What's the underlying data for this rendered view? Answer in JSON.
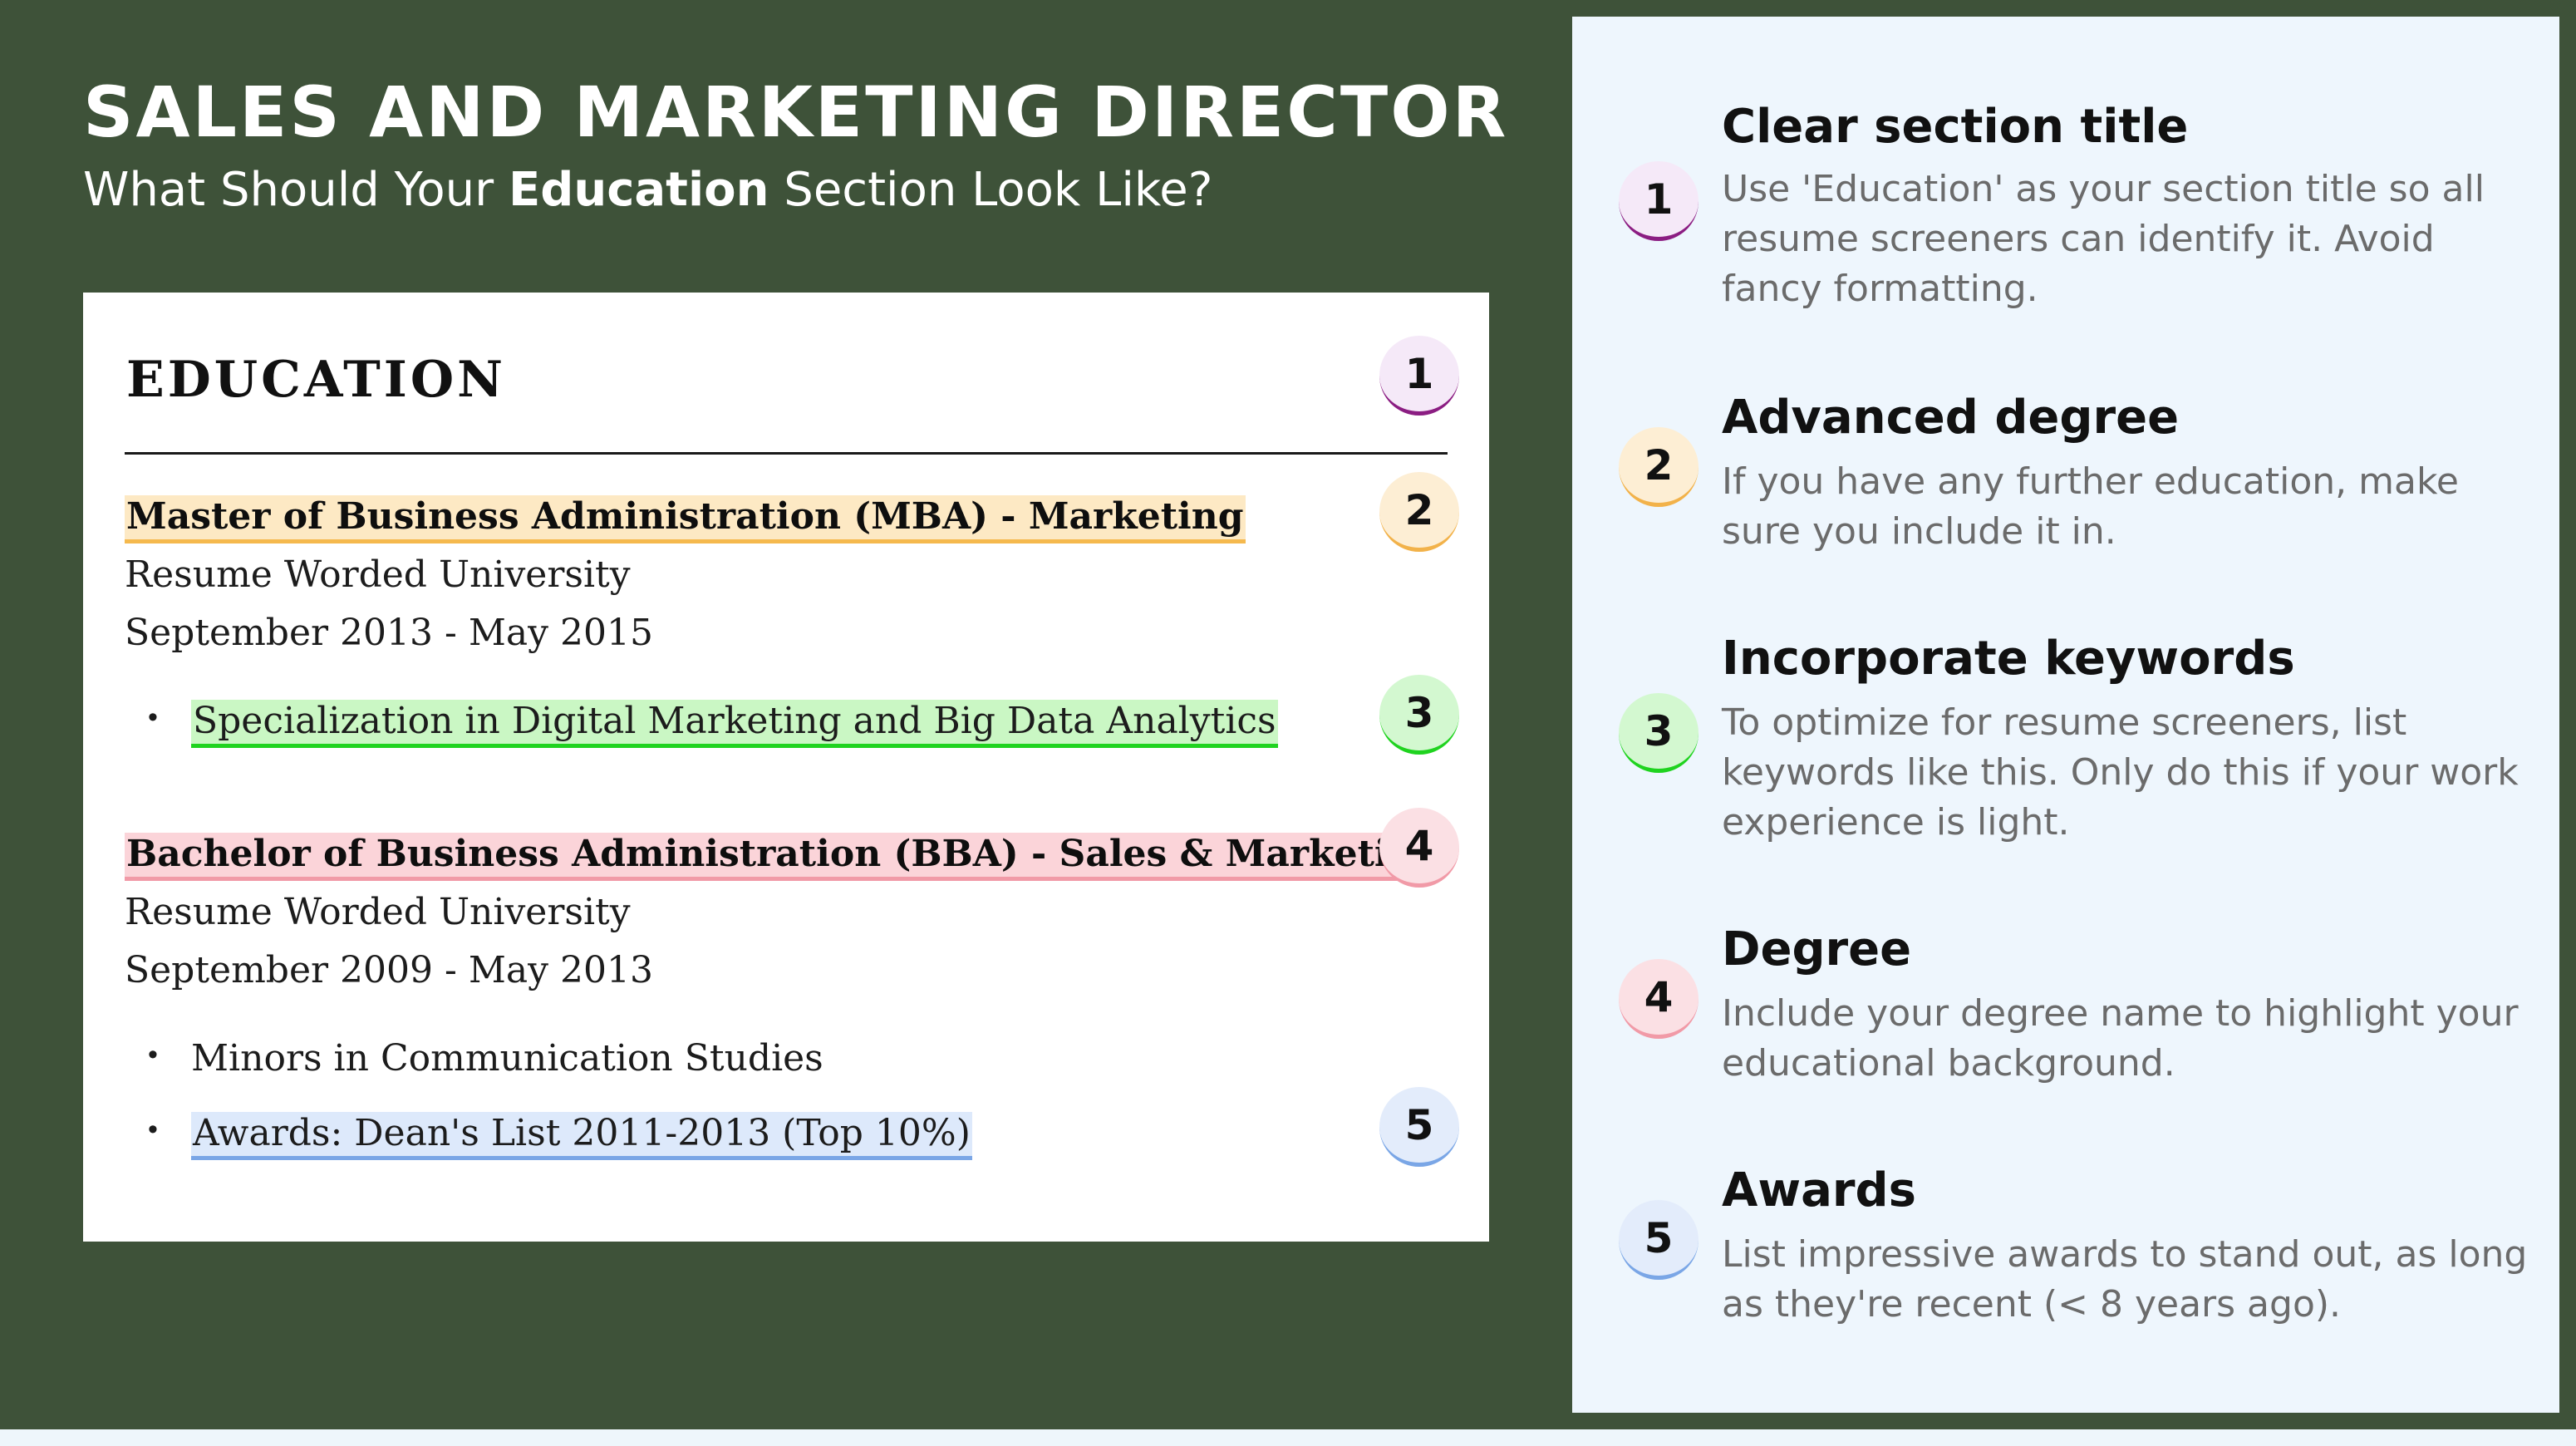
{
  "header": {
    "title": "SALES AND MARKETING DIRECTOR",
    "subtitle_prefix": "What Should Your ",
    "subtitle_bold": "Education",
    "subtitle_suffix": " Section Look Like?"
  },
  "resume": {
    "section_title": "EDUCATION",
    "entries": [
      {
        "degree": "Master of Business Administration (MBA) - Marketing",
        "school": "Resume Worded University",
        "dates": "September 2013 - May 2015",
        "bullets": [
          "Specialization in Digital Marketing and Big Data Analytics"
        ]
      },
      {
        "degree": "Bachelor of Business Administration (BBA) - Sales & Marketing",
        "school": "Resume Worded University",
        "dates": "September 2009 - May 2013",
        "bullets": [
          "Minors in Communication Studies",
          "Awards: Dean's List 2011-2013 (Top 10%)"
        ]
      }
    ],
    "bullet_symbol": "•"
  },
  "badges": [
    "1",
    "2",
    "3",
    "4",
    "5"
  ],
  "tips": [
    {
      "number": "1",
      "title": "Clear section title",
      "text": "Use 'Education' as your section title so all resume screeners can identify it. Avoid fancy formatting."
    },
    {
      "number": "2",
      "title": "Advanced degree",
      "text": "If you have any further education, make sure you include it in."
    },
    {
      "number": "3",
      "title": "Incorporate keywords",
      "text": "To optimize for resume screeners, list keywords like this. Only do this if your work experience is light."
    },
    {
      "number": "4",
      "title": "Degree",
      "text": "Include your degree name to highlight your educational background."
    },
    {
      "number": "5",
      "title": "Awards",
      "text": "List impressive awards to stand out, as long as they're recent (< 8 years ago)."
    }
  ],
  "colors": {
    "background": "#3e5239",
    "panel": "#eef6fd",
    "badge_1": "#8b1d82",
    "badge_2": "#f2b24a",
    "badge_3": "#1fd31f",
    "badge_4": "#f19aa7",
    "badge_5": "#7aa6e6"
  }
}
